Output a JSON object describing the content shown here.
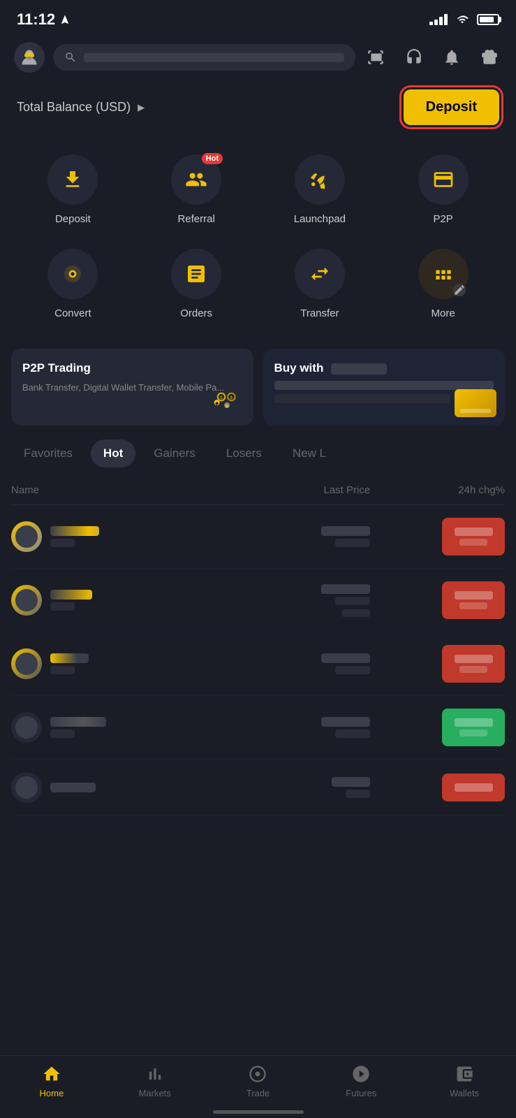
{
  "statusBar": {
    "time": "11:12",
    "locationArrow": "▶"
  },
  "header": {
    "searchPlaceholder": "Search"
  },
  "balance": {
    "label": "Total Balance (USD)",
    "arrow": "▶",
    "depositButton": "Deposit"
  },
  "quickActions": {
    "row1": [
      {
        "id": "deposit",
        "label": "Deposit"
      },
      {
        "id": "referral",
        "label": "Referral",
        "hot": true
      },
      {
        "id": "launchpad",
        "label": "Launchpad"
      },
      {
        "id": "p2p",
        "label": "P2P"
      }
    ],
    "row2": [
      {
        "id": "convert",
        "label": "Convert"
      },
      {
        "id": "orders",
        "label": "Orders"
      },
      {
        "id": "transfer",
        "label": "Transfer"
      },
      {
        "id": "more",
        "label": "More"
      }
    ]
  },
  "banners": {
    "p2p": {
      "title": "P2P Trading",
      "subtitle": "Bank Transfer, Digital Wallet Transfer, Mobile Pa..."
    },
    "buy": {
      "title": "Buy with"
    }
  },
  "marketTabs": [
    {
      "id": "favorites",
      "label": "Favorites",
      "active": false
    },
    {
      "id": "hot",
      "label": "Hot",
      "active": true
    },
    {
      "id": "gainers",
      "label": "Gainers",
      "active": false
    },
    {
      "id": "losers",
      "label": "Losers",
      "active": false
    },
    {
      "id": "new",
      "label": "New L",
      "active": false
    }
  ],
  "marketTable": {
    "headers": {
      "name": "Name",
      "price": "Last Price",
      "change": "24h chg%"
    },
    "rows": [
      {
        "id": 1,
        "changeType": "red"
      },
      {
        "id": 2,
        "changeType": "red"
      },
      {
        "id": 3,
        "changeType": "red"
      },
      {
        "id": 4,
        "changeType": "green"
      },
      {
        "id": 5,
        "changeType": "red"
      }
    ]
  },
  "bottomNav": [
    {
      "id": "home",
      "label": "Home",
      "active": true
    },
    {
      "id": "markets",
      "label": "Markets",
      "active": false
    },
    {
      "id": "trade",
      "label": "Trade",
      "active": false
    },
    {
      "id": "futures",
      "label": "Futures",
      "active": false
    },
    {
      "id": "wallets",
      "label": "Wallets",
      "active": false
    }
  ]
}
